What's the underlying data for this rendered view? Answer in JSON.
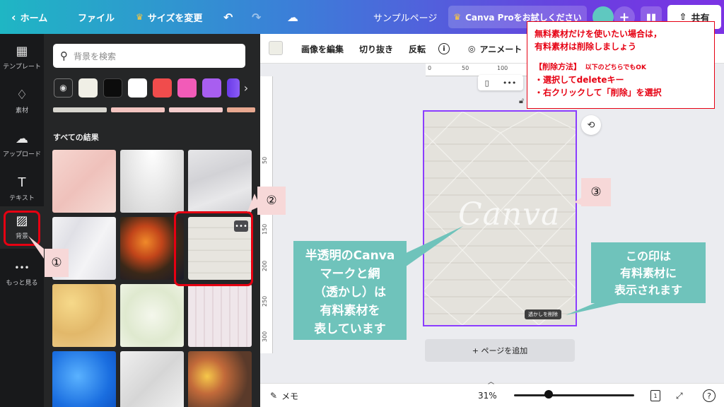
{
  "topbar": {
    "home": "ホーム",
    "file": "ファイル",
    "resize": "サイズを変更",
    "title": "サンプルページ",
    "pro": "Canva Proをお試しください",
    "share": "共有"
  },
  "rail": [
    {
      "label": "テンプレート",
      "icon": "▦"
    },
    {
      "label": "素材",
      "icon": "♢"
    },
    {
      "label": "アップロード",
      "icon": "☁"
    },
    {
      "label": "テキスト",
      "icon": "T"
    },
    {
      "label": "背景",
      "icon": "▨"
    },
    {
      "label": "もっと見る",
      "icon": "•••"
    }
  ],
  "panel": {
    "search_placeholder": "背景を検索",
    "swatches": [
      "#f0efe6",
      "#0c0c0c",
      "#ffffff",
      "#f04c4c",
      "#f25bb8",
      "#a85ef0",
      "#6a3ae8"
    ],
    "section_title": "すべての結果",
    "more": "•••"
  },
  "toolbar": {
    "edit_image": "画像を編集",
    "crop": "切り抜き",
    "flip": "反転",
    "info": "i",
    "animate": "アニメート"
  },
  "ruler": {
    "top": [
      "0",
      "50",
      "100"
    ],
    "left": [
      "50",
      "100",
      "150",
      "200",
      "250",
      "300"
    ]
  },
  "canvas": {
    "watermark_text": "Canva",
    "remove_watermark": "透かしを削除",
    "add_page": "+ ページを追加"
  },
  "bottombar": {
    "notes": "メモ",
    "zoom": "31%",
    "page_count": "1"
  },
  "annotations": {
    "n1": "①",
    "n2": "②",
    "n3": "③",
    "note_left": [
      "半透明のCanva",
      "マークと網",
      "（透かし）は",
      "有料素材を",
      "表しています"
    ],
    "note_right": [
      "この印は",
      "有料素材に",
      "表示されます"
    ],
    "red_title_1": "無料素材だけを使いたい場合は，",
    "red_title_2": "有料素材は削除しましょう",
    "red_method": "【削除方法】",
    "red_method_sub": "以下のどちらでもOK",
    "red_item_1": "・選択してdeleteキー",
    "red_item_2": "・右クリックして「削除」を選択"
  },
  "colors": {
    "accent": "#8b3dff",
    "annotation_red": "#e60012",
    "annotation_teal": "#6fc3bb"
  }
}
